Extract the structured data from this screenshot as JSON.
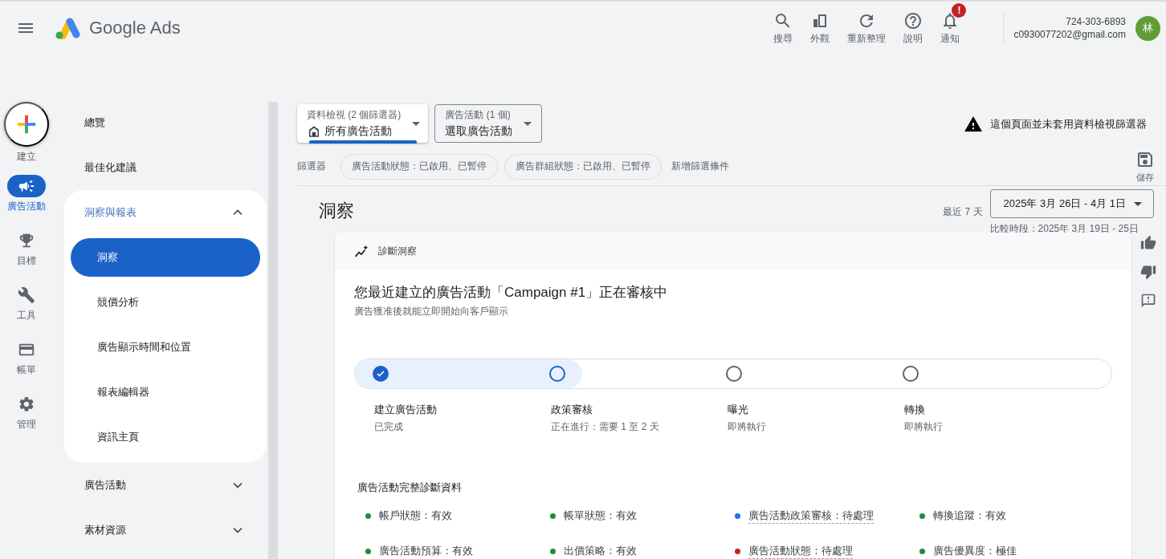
{
  "header": {
    "product": "Google Ads",
    "actions": [
      {
        "label": "搜尋"
      },
      {
        "label": "外觀"
      },
      {
        "label": "重新整理"
      },
      {
        "label": "說明"
      },
      {
        "label": "通知",
        "badge": "!"
      }
    ],
    "account": {
      "phone": "724-303-6893",
      "email": "c0930077202@gmail.com",
      "avatar": "林"
    }
  },
  "rail": {
    "create": "建立",
    "items": [
      {
        "label": "廣告活動",
        "selected": true
      },
      {
        "label": "目標",
        "selected": false
      },
      {
        "label": "工具",
        "selected": false
      },
      {
        "label": "帳單",
        "selected": false
      },
      {
        "label": "管理",
        "selected": false
      }
    ]
  },
  "nav": {
    "items": [
      {
        "kind": "link",
        "label": "總覽"
      },
      {
        "kind": "link",
        "label": "最佳化建議"
      },
      {
        "kind": "group",
        "label": "洞察與報表",
        "expanded": true,
        "children": [
          {
            "label": "洞察",
            "selected": true
          },
          {
            "label": "競價分析",
            "selected": false
          },
          {
            "label": "廣告顯示時間和位置",
            "selected": false
          },
          {
            "label": "報表編輯器",
            "selected": false
          },
          {
            "label": "資訊主頁",
            "selected": false
          }
        ]
      },
      {
        "kind": "group",
        "label": "廣告活動",
        "expanded": false
      },
      {
        "kind": "group",
        "label": "素材資源",
        "expanded": false
      }
    ]
  },
  "toolbar": {
    "view_selector": {
      "caption": "資料檢視 (2 個篩選器)",
      "value": "所有廣告活動"
    },
    "campaign_selector": {
      "caption": "廣告活動 (1 個)",
      "value": "選取廣告活動"
    },
    "warning": "這個頁面並未套用資料檢視篩選器",
    "filters_label": "篩選器",
    "filters": [
      "廣告活動狀態：已啟用、已暫停",
      "廣告群組狀態：已啟用、已暫停"
    ],
    "add_filter": "新增篩選條件",
    "save": "儲存"
  },
  "page": {
    "title": "洞察",
    "range_label": "最近 7 天",
    "date_range": "2025年 3月 26日 - 4月 1日",
    "compare": "比較時段：2025年 3月 19日 - 25日"
  },
  "card": {
    "header": "診斷洞察",
    "title": "您最近建立的廣告活動「Campaign #1」正在審核中",
    "subtitle": "廣告獲准後就能立即開始向客戶顯示",
    "progress": {
      "level": 0.3
    },
    "steps": [
      {
        "label": "建立廣告活動",
        "status": "已完成",
        "completed": true
      },
      {
        "label": "政策審核",
        "status": "正在進行：需要 1 至 2 天",
        "completed": false
      },
      {
        "label": "曝光",
        "status": "即將執行",
        "completed": false
      },
      {
        "label": "轉換",
        "status": "即將執行",
        "completed": false
      }
    ],
    "diagnostics": {
      "title": "廣告活動完整診斷資料",
      "items": [
        {
          "text": "帳戶狀態：有效",
          "color": "#1e8e3e",
          "linked": false
        },
        {
          "text": "帳單狀態：有效",
          "color": "#1e8e3e",
          "linked": false
        },
        {
          "text": "廣告活動政策審核：待處理",
          "color": "#1a73e8",
          "linked": true
        },
        {
          "text": "轉換追蹤：有效",
          "color": "#1e8e3e",
          "linked": false
        },
        {
          "text": "廣告活動預算：有效",
          "color": "#1e8e3e",
          "linked": false
        },
        {
          "text": "出價策略：有效",
          "color": "#1e8e3e",
          "linked": false
        },
        {
          "text": "廣告活動狀態：待處理",
          "color": "#c5221f",
          "linked": true
        },
        {
          "text": "廣告優異度：極佳",
          "color": "#1e8e3e",
          "linked": false
        }
      ]
    }
  }
}
